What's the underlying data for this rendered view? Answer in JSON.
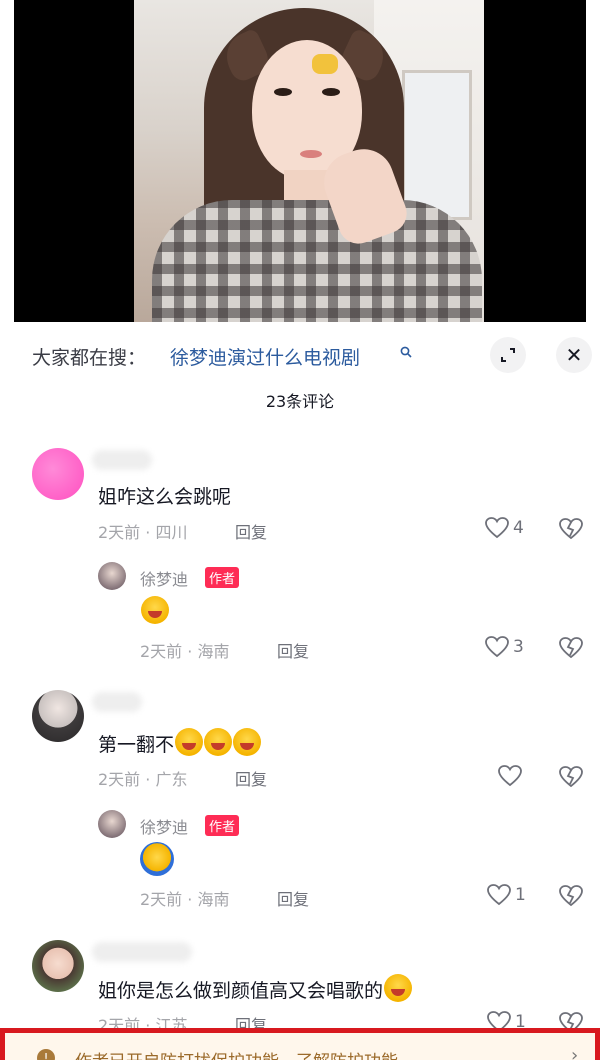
{
  "search": {
    "prefix": "大家都在搜：",
    "query": "徐梦迪演过什么电视剧",
    "search_icon": "search-icon"
  },
  "controls": {
    "expand_icon": "expand-icon",
    "close_icon": "close-icon",
    "close_symbol": "✕"
  },
  "comments_header": {
    "count_label": "23条评论"
  },
  "comments": [
    {
      "text": "姐咋这么会跳呢",
      "time": "2天前",
      "location": "四川",
      "reply_label": "回复",
      "likes": "4",
      "reply": {
        "author": "徐梦迪",
        "badge": "作者",
        "emoji": "laugh-cry-emoji",
        "time": "2天前",
        "location": "海南",
        "reply_label": "回复",
        "likes": "3"
      }
    },
    {
      "text": "第一翻不",
      "emojis": [
        "laugh-cry-emoji",
        "laugh-cry-emoji",
        "laugh-cry-emoji"
      ],
      "time": "2天前",
      "location": "广东",
      "reply_label": "回复",
      "likes": "",
      "reply": {
        "author": "徐梦迪",
        "badge": "作者",
        "emoji": "blue-laugh-emoji",
        "time": "2天前",
        "location": "海南",
        "reply_label": "回复",
        "likes": "1"
      }
    },
    {
      "text": "姐你是怎么做到颜值高又会唱歌的",
      "emojis": [
        "pleading-emoji"
      ],
      "time": "2天前",
      "location": "江苏",
      "reply_label": "回复",
      "likes": "1"
    }
  ],
  "warning": {
    "text": "作者已开启防打扰保护功能，",
    "link": "了解防护功能",
    "icon": "info-icon",
    "chevron": "›"
  },
  "colors": {
    "accent_link": "#2c5b9e",
    "author_badge": "#fe2c55",
    "warning_border": "#d8191f"
  }
}
